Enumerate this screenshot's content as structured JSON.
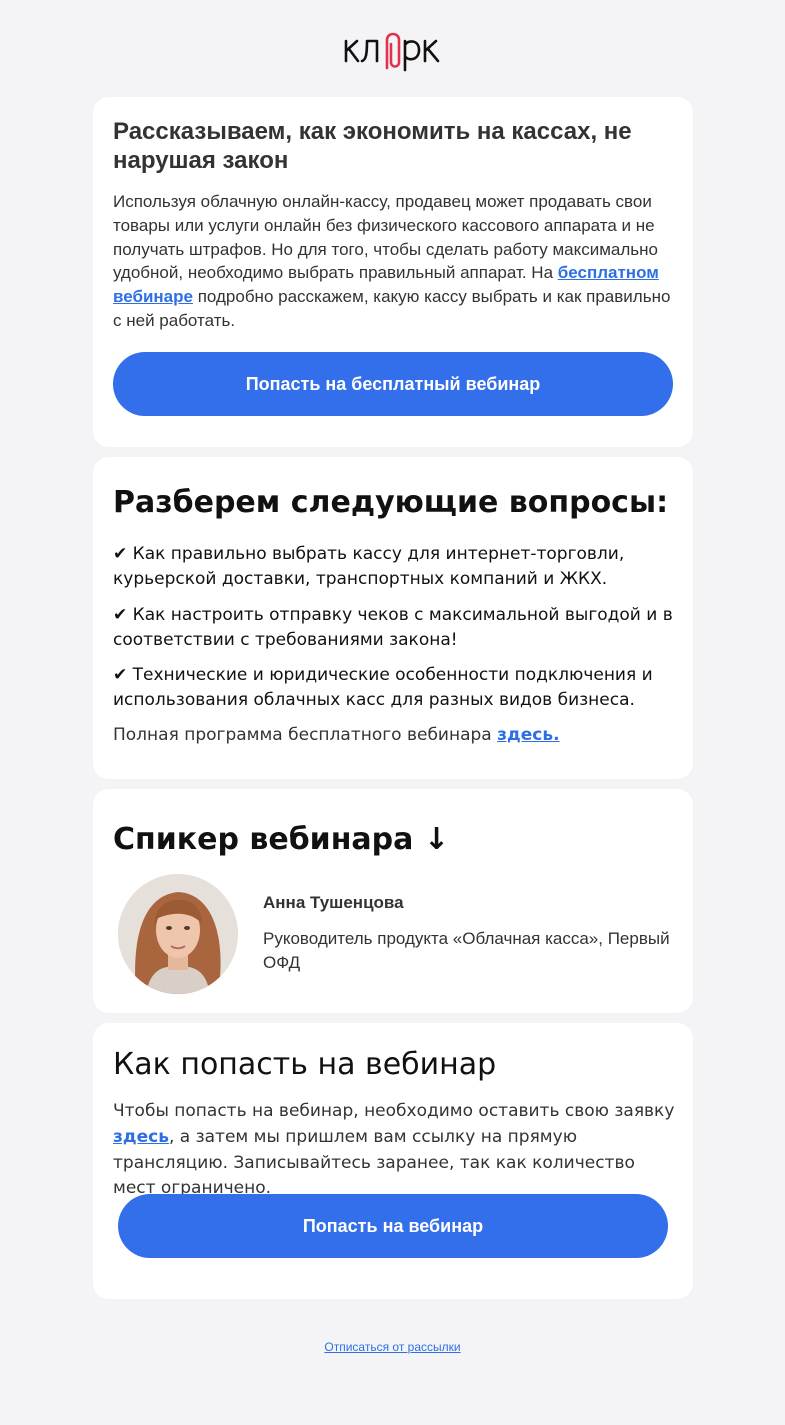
{
  "brand": {
    "logo_text": "клерк",
    "accent": "#e0314f"
  },
  "colors": {
    "button": "#336fea",
    "link": "#2e6fe6",
    "background": "#f4f4f6"
  },
  "intro": {
    "title": "Рассказываем, как экономить на кассах, не нарушая закон",
    "text_before_link": "Используя облачную онлайн-кассу, продавец может продавать свои товары или услуги онлайн без физического кассового аппарата и не получать штрафов. Но для того, чтобы сделать работу максимально удобной, необходимо выбрать правильный аппарат. На ",
    "link_text": "бесплатном вебинаре",
    "text_after_link": " подробно расскажем, какую кассу выбрать и как правильно с ней работать.",
    "button_label": "Попасть на бесплатный вебинар"
  },
  "questions": {
    "title": "Разберем следующие вопросы:",
    "items": [
      "✔ Как правильно выбрать кассу для интернет-торговли, курьерской доставки, транспортных компаний и ЖКХ.",
      "✔ Как настроить отправку чеков с максимальной выгодой и в соответствии с требованиями закона!",
      "✔ Технические и юридические особенности подключения и использования облачных касс для разных видов бизнеса."
    ],
    "program_text": "Полная программа бесплатного вебинара ",
    "program_link": "здесь."
  },
  "speaker": {
    "title": "Спикер вебинара ↓",
    "name": "Анна Тушенцова",
    "role": "Руководитель продукта «Облачная касса», Первый ОФД"
  },
  "howto": {
    "title": "Как попасть на вебинар",
    "text_before_link": "Чтобы попасть на вебинар, необходимо оставить свою заявку ",
    "link_text": "здесь",
    "text_after_link": ", а затем мы пришлем вам ссылку на прямую трансляцию. Записывайтесь заранее, так как количество мест ограничено.",
    "button_label": "Попасть на вебинар"
  },
  "footer": {
    "unsubscribe": "Отписаться от рассылки"
  }
}
